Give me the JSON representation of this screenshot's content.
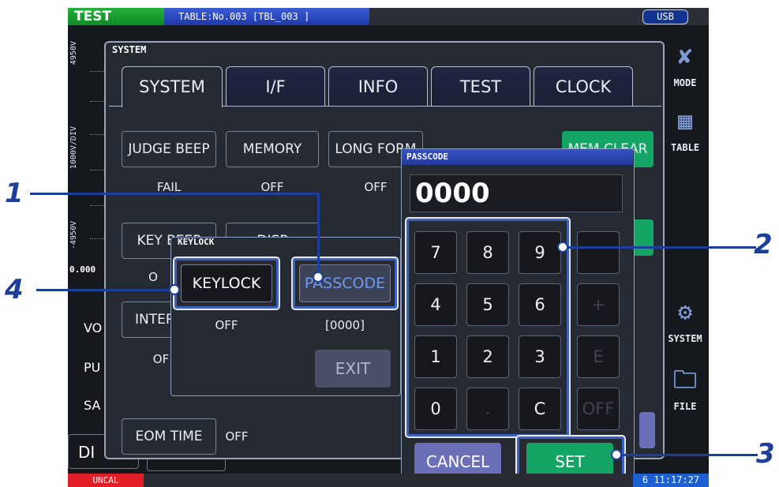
{
  "topbar": {
    "mode": "TEST",
    "table": "TABLE:No.003 [TBL_003       ]",
    "usb": "USB"
  },
  "bottombar": {
    "status": "UNCAL",
    "time": "6 11:17:27"
  },
  "chart_edge": {
    "top_label": "4950V",
    "mid_label": "1000V/DIV",
    "bottom_label": "-4950V",
    "x_start": "0.000"
  },
  "left_panel_partial": {
    "vo": "VO",
    "pu": "PU",
    "sa": "SA",
    "di": "DI"
  },
  "sidebar": {
    "items": [
      {
        "label": "MODE",
        "icon": "test-mode-icon"
      },
      {
        "label": "TABLE",
        "icon": "table-icon"
      },
      {
        "label": "SYSTEM",
        "icon": "gear-icon"
      },
      {
        "label": "FILE",
        "icon": "folder-icon"
      }
    ]
  },
  "system_window": {
    "title": "SYSTEM",
    "tabs": [
      "SYSTEM",
      "I/F",
      "INFO",
      "TEST",
      "CLOCK"
    ],
    "judge_beep": {
      "label": "JUDGE BEEP",
      "value": "FAIL"
    },
    "memory": {
      "label": "MEMORY",
      "value": "OFF"
    },
    "long_form": {
      "label": "LONG FORM",
      "value": "OFF"
    },
    "mem_clear": "MEM CLEAR",
    "key_beep": {
      "label": "KEY BEEP",
      "value": "O"
    },
    "disp": {
      "label": "DISP"
    },
    "interlock": {
      "label": "INTER",
      "value": "OF"
    },
    "eom_time": {
      "label": "EOM TIME",
      "value": "OFF"
    }
  },
  "keylock_dialog": {
    "title": "KEYLOCK",
    "keylock_label": "KEYLOCK",
    "keylock_value": "OFF",
    "passcode_label": "PASSCODE",
    "passcode_value": "[0000]",
    "exit_label": "EXIT"
  },
  "passcode_dialog": {
    "title": "PASSCODE",
    "display": "0000",
    "keys": [
      "7",
      "8",
      "9",
      "4",
      "5",
      "6",
      "1",
      "2",
      "3",
      "0",
      ".",
      "C"
    ],
    "cancel_label": "CANCEL",
    "set_label": "SET",
    "dim_keys": [
      "+",
      "E",
      "OFF"
    ]
  },
  "callouts": [
    "1",
    "2",
    "3",
    "4"
  ],
  "colors": {
    "mode_green": "#1c9c31",
    "set_green": "#14a463",
    "cancel_purple": "#6b6fb7",
    "highlight_blue": "#3e5fc4",
    "callout_blue": "#1c3f9c",
    "uncal_red": "#e21f26"
  }
}
